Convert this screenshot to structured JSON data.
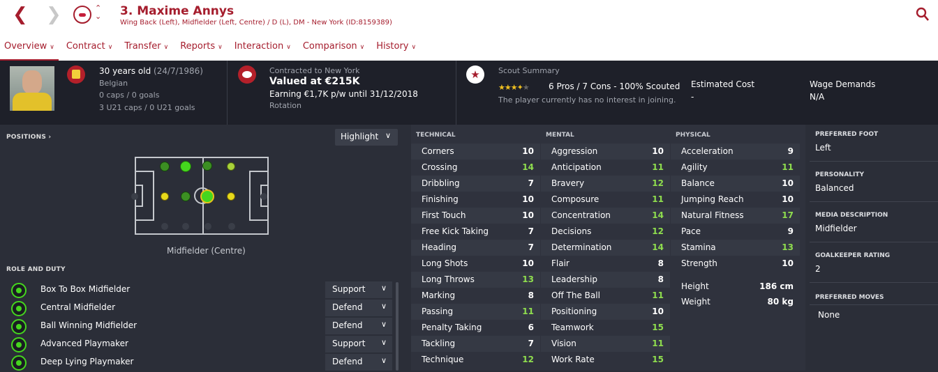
{
  "header": {
    "player_name": "3. Maxime Annys",
    "subtitle": "Wing Back (Left), Midfielder (Left, Centre) / D (L), DM - New York (ID:8159389)"
  },
  "tabs": [
    {
      "label": "Overview"
    },
    {
      "label": "Contract"
    },
    {
      "label": "Transfer"
    },
    {
      "label": "Reports"
    },
    {
      "label": "Interaction"
    },
    {
      "label": "Comparison"
    },
    {
      "label": "History"
    }
  ],
  "info": {
    "age": "30 years old",
    "dob": "(24/7/1986)",
    "nationality": "Belgian",
    "caps": "0 caps / 0 goals",
    "u21_caps": "3 U21 caps / 0 U21 goals",
    "contracted_to": "Contracted to New York",
    "valued": "Valued at €215K",
    "earning": "Earning €1,7K p/w until 31/12/2018",
    "squad_status": "Rotation",
    "scout_title": "Scout Summary",
    "scout_summary": "6 Pros / 7 Cons - 100% Scouted",
    "scout_rating_stars": 3.5,
    "interest": "The player currently has no interest in joining.",
    "estimated_cost_label": "Estimated Cost",
    "estimated_cost_value": "-",
    "wage_demands_label": "Wage Demands",
    "wage_demands_value": "N/A"
  },
  "positions": {
    "title": "POSITIONS",
    "highlight_label": "Highlight",
    "selected_position": "Midfielder (Centre)"
  },
  "roles": {
    "title": "ROLE AND DUTY",
    "items": [
      {
        "name": "Box To Box Midfielder",
        "duty": "Support"
      },
      {
        "name": "Central Midfielder",
        "duty": "Defend"
      },
      {
        "name": "Ball Winning Midfielder",
        "duty": "Defend"
      },
      {
        "name": "Advanced Playmaker",
        "duty": "Support"
      },
      {
        "name": "Deep Lying Playmaker",
        "duty": "Defend"
      }
    ]
  },
  "technical": {
    "title": "TECHNICAL",
    "items": [
      {
        "name": "Corners",
        "value": "10"
      },
      {
        "name": "Crossing",
        "value": "14"
      },
      {
        "name": "Dribbling",
        "value": "7"
      },
      {
        "name": "Finishing",
        "value": "10"
      },
      {
        "name": "First Touch",
        "value": "10"
      },
      {
        "name": "Free Kick Taking",
        "value": "7"
      },
      {
        "name": "Heading",
        "value": "7"
      },
      {
        "name": "Long Shots",
        "value": "10"
      },
      {
        "name": "Long Throws",
        "value": "13"
      },
      {
        "name": "Marking",
        "value": "8"
      },
      {
        "name": "Passing",
        "value": "11"
      },
      {
        "name": "Penalty Taking",
        "value": "6"
      },
      {
        "name": "Tackling",
        "value": "7"
      },
      {
        "name": "Technique",
        "value": "12"
      }
    ]
  },
  "mental": {
    "title": "MENTAL",
    "items": [
      {
        "name": "Aggression",
        "value": "10"
      },
      {
        "name": "Anticipation",
        "value": "11"
      },
      {
        "name": "Bravery",
        "value": "12"
      },
      {
        "name": "Composure",
        "value": "11"
      },
      {
        "name": "Concentration",
        "value": "14"
      },
      {
        "name": "Decisions",
        "value": "12"
      },
      {
        "name": "Determination",
        "value": "14"
      },
      {
        "name": "Flair",
        "value": "8"
      },
      {
        "name": "Leadership",
        "value": "8"
      },
      {
        "name": "Off The Ball",
        "value": "11"
      },
      {
        "name": "Positioning",
        "value": "10"
      },
      {
        "name": "Teamwork",
        "value": "15"
      },
      {
        "name": "Vision",
        "value": "11"
      },
      {
        "name": "Work Rate",
        "value": "15"
      }
    ]
  },
  "physical": {
    "title": "PHYSICAL",
    "items": [
      {
        "name": "Acceleration",
        "value": "9"
      },
      {
        "name": "Agility",
        "value": "11"
      },
      {
        "name": "Balance",
        "value": "10"
      },
      {
        "name": "Jumping Reach",
        "value": "10"
      },
      {
        "name": "Natural Fitness",
        "value": "17"
      },
      {
        "name": "Pace",
        "value": "9"
      },
      {
        "name": "Stamina",
        "value": "13"
      },
      {
        "name": "Strength",
        "value": "10"
      }
    ],
    "height_label": "Height",
    "height_value": "186 cm",
    "weight_label": "Weight",
    "weight_value": "80 kg"
  },
  "side": {
    "preferred_foot_title": "PREFERRED FOOT",
    "preferred_foot": "Left",
    "personality_title": "PERSONALITY",
    "personality": "Balanced",
    "media_title": "MEDIA DESCRIPTION",
    "media": "Midfielder",
    "gk_title": "GOALKEEPER RATING",
    "gk": "2",
    "moves_title": "PREFERRED MOVES",
    "moves": "None"
  },
  "colors": {
    "accent": "#a51d2d",
    "high_value": "#8fdd4e",
    "background": "#2b2e38"
  }
}
